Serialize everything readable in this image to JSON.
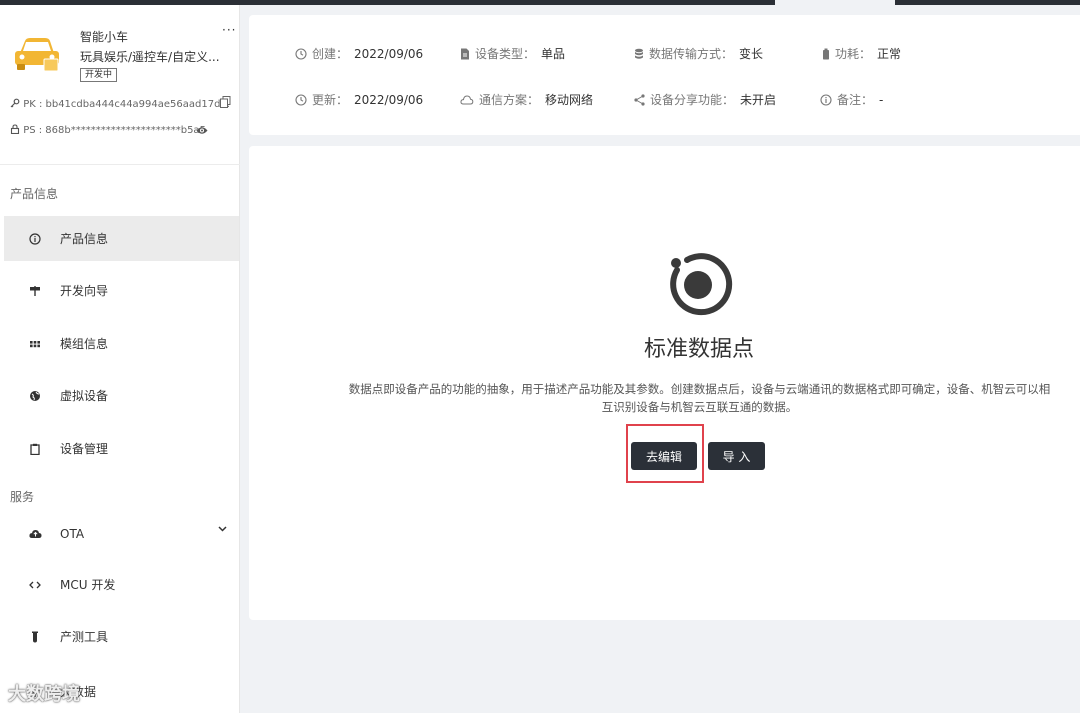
{
  "product": {
    "name": "智能小车",
    "category": "玩具娱乐/遥控车/自定义...",
    "status": "开发中",
    "more": "···",
    "pk": "PK : bb41cdba444c44a994ae56aad17d...",
    "ps": "PS : 868b**********************b5a5"
  },
  "sidebar": {
    "section1": "产品信息",
    "items": [
      {
        "label": "产品信息",
        "icon": "info-icon"
      },
      {
        "label": "开发向导",
        "icon": "signpost-icon"
      },
      {
        "label": "模组信息",
        "icon": "module-icon"
      },
      {
        "label": "虚拟设备",
        "icon": "globe-icon"
      },
      {
        "label": "设备管理",
        "icon": "clipboard-icon"
      }
    ],
    "section2": "服务",
    "service_items": [
      {
        "label": "OTA",
        "icon": "cloud-icon"
      },
      {
        "label": "MCU 开发",
        "icon": "code-icon"
      },
      {
        "label": "产测工具",
        "icon": "test-tube-icon"
      }
    ],
    "partial_item": "大数据"
  },
  "watermark": "大数跨境",
  "info": {
    "created_label": "创建：",
    "created_value": "2022/09/06",
    "device_type_label": "设备类型：",
    "device_type_value": "单品",
    "transfer_label": "数据传输方式：",
    "transfer_value": "变长",
    "power_label": "功耗：",
    "power_value": "正常",
    "updated_label": "更新：",
    "updated_value": "2022/09/06",
    "comm_label": "通信方案：",
    "comm_value": "移动网络",
    "share_label": "设备分享功能：",
    "share_value": "未开启",
    "note_label": "备注：",
    "note_value": "-"
  },
  "datapoint": {
    "title": "标准数据点",
    "description": "数据点即设备产品的功能的抽象，用于描述产品功能及其参数。创建数据点后，设备与云端通讯的数据格式即可确定，设备、机智云可以相互识别设备与机智云互联互通的数据。",
    "edit_button": "去编辑",
    "import_button": "导 入"
  },
  "colors": {
    "dark_button": "#2b3038",
    "highlight": "#e0424c",
    "car": "#f2b634"
  }
}
